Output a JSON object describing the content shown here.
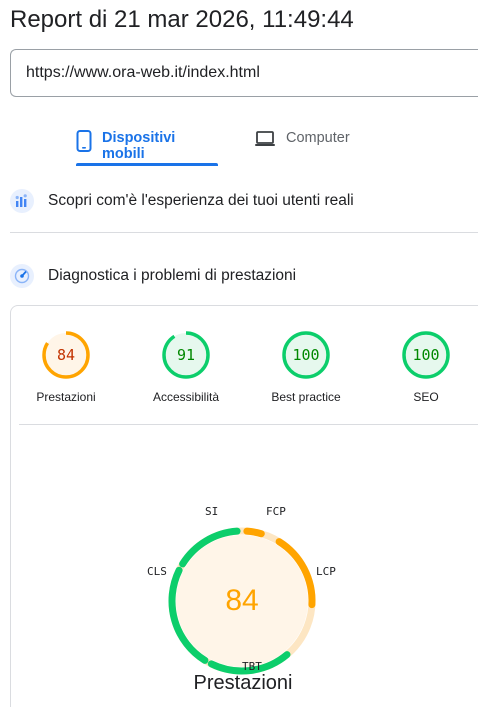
{
  "report": {
    "title": "Report di 21 mar 2026, 11:49:44"
  },
  "url_input": {
    "value": "https://www.ora-web.it/index.html"
  },
  "tabs": [
    {
      "label": "Dispositivi mobili",
      "icon": "smartphone-icon",
      "active": true
    },
    {
      "label": "Computer",
      "icon": "laptop-icon",
      "active": false
    }
  ],
  "sections": {
    "real_users": {
      "label": "Scopri com'è l'esperienza dei tuoi utenti reali",
      "icon": "crux-chart-icon"
    },
    "diagnostics": {
      "label": "Diagnostica i problemi di prestazioni",
      "icon": "lighthouse-icon"
    }
  },
  "scores": [
    {
      "label": "Prestazioni",
      "value": 84,
      "status": "average"
    },
    {
      "label": "Accessibilità",
      "value": 91,
      "status": "pass"
    },
    {
      "label": "Best practice",
      "value": 100,
      "status": "pass"
    },
    {
      "label": "SEO",
      "value": 100,
      "status": "pass"
    }
  ],
  "performance_gauge": {
    "score": 84,
    "title": "Prestazioni",
    "metrics": [
      {
        "name": "SI",
        "status": "pass"
      },
      {
        "name": "FCP",
        "status": "average"
      },
      {
        "name": "LCP",
        "status": "average"
      },
      {
        "name": "TBT",
        "status": "pass"
      },
      {
        "name": "CLS",
        "status": "pass"
      }
    ]
  },
  "colors": {
    "pass": "#0cce6b",
    "pass_text": "#008800",
    "pass_fill": "#e6f8ee",
    "average": "#ffa400",
    "average_text": "#c33300",
    "average_fill": "#fff5e8",
    "average_track": "#fde6c3",
    "accent": "#1a73e8"
  }
}
